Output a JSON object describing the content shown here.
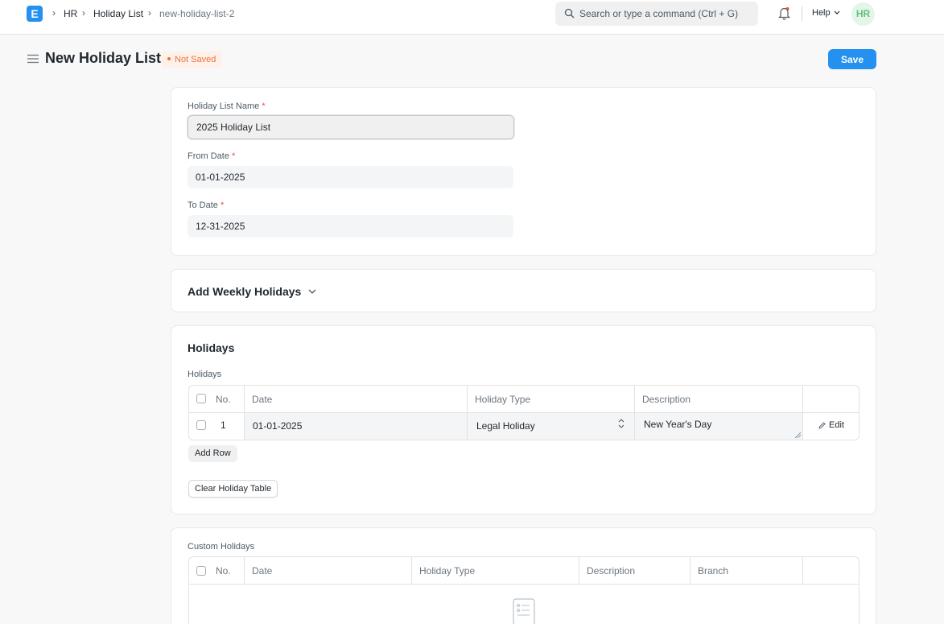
{
  "navbar": {
    "logo_letter": "E",
    "breadcrumbs": [
      "HR",
      "Holiday List",
      "new-holiday-list-2"
    ],
    "search_placeholder": "Search or type a command (Ctrl + G)",
    "help_label": "Help",
    "avatar_initials": "HR"
  },
  "page": {
    "title": "New Holiday List",
    "status": "Not Saved",
    "save_label": "Save"
  },
  "form": {
    "holiday_list_name": {
      "label": "Holiday List Name",
      "required": "*",
      "value": "2025 Holiday List"
    },
    "from_date": {
      "label": "From Date",
      "required": "*",
      "value": "01-01-2025"
    },
    "to_date": {
      "label": "To Date",
      "required": "*",
      "value": "12-31-2025"
    }
  },
  "weekly": {
    "title": "Add Weekly Holidays"
  },
  "holidays": {
    "section_title": "Holidays",
    "table_label": "Holidays",
    "columns": {
      "no": "No.",
      "date": "Date",
      "holiday_type": "Holiday Type",
      "description": "Description"
    },
    "rows": [
      {
        "no": "1",
        "date": "01-01-2025",
        "holiday_type": "Legal Holiday",
        "description": "New Year's Day",
        "edit": "Edit"
      }
    ],
    "add_row": "Add Row",
    "clear_table": "Clear Holiday Table"
  },
  "custom_holidays": {
    "table_label": "Custom Holidays",
    "columns": {
      "no": "No.",
      "date": "Date",
      "holiday_type": "Holiday Type",
      "description": "Description",
      "branch": "Branch"
    }
  },
  "colors": {
    "primary": "#2490ef",
    "status": "#e8743b",
    "avatar_bg": "#e4f5e9",
    "avatar_text": "#64c27b"
  }
}
